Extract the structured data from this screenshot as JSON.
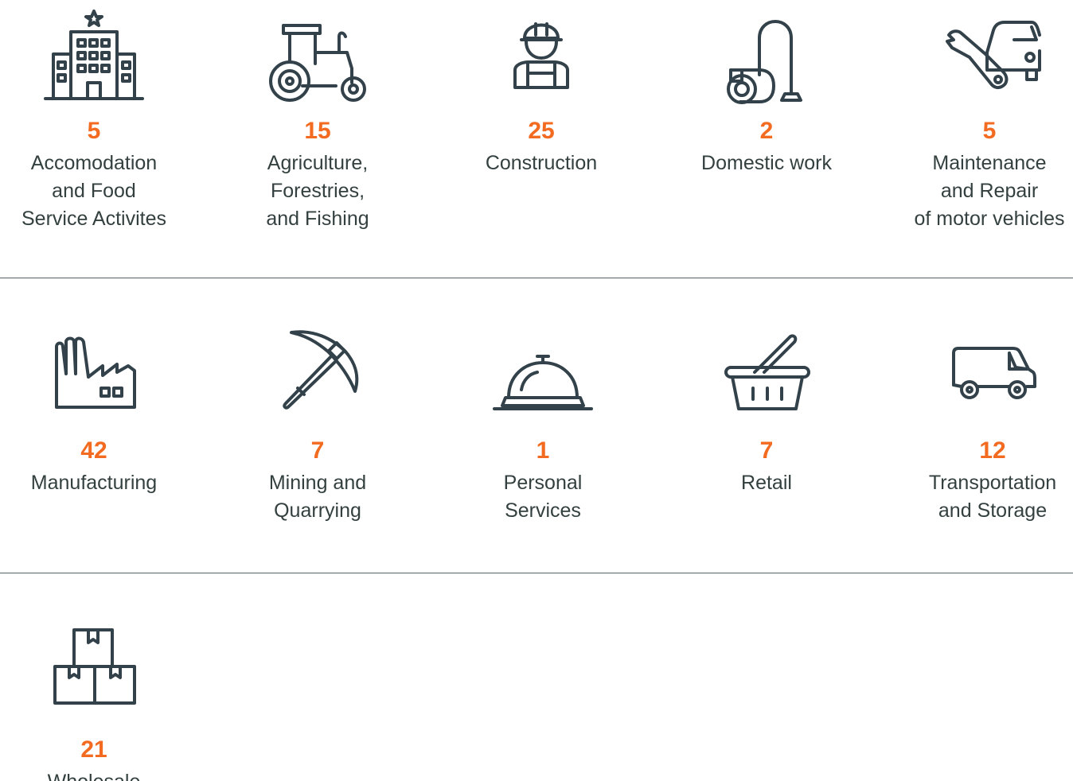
{
  "colors": {
    "accent": "#f26b21",
    "icon": "#33424a",
    "text": "#33403f",
    "divider": "#556066"
  },
  "sectors": [
    {
      "icon": "hotel-icon",
      "count": "5",
      "label": "Accomodation\nand Food\nService Activites"
    },
    {
      "icon": "tractor-icon",
      "count": "15",
      "label": "Agriculture,\nForestries,\nand Fishing"
    },
    {
      "icon": "construction-worker-icon",
      "count": "25",
      "label": "Construction"
    },
    {
      "icon": "vacuum-cleaner-icon",
      "count": "2",
      "label": "Domestic work"
    },
    {
      "icon": "car-wrench-icon",
      "count": "5",
      "label": "Maintenance\nand Repair\nof motor vehicles"
    },
    {
      "icon": "factory-icon",
      "count": "42",
      "label": "Manufacturing"
    },
    {
      "icon": "pickaxe-icon",
      "count": "7",
      "label": "Mining and\nQuarrying"
    },
    {
      "icon": "service-bell-icon",
      "count": "1",
      "label": "Personal\nServices"
    },
    {
      "icon": "shopping-basket-icon",
      "count": "7",
      "label": "Retail"
    },
    {
      "icon": "van-icon",
      "count": "12",
      "label": "Transportation\nand Storage"
    },
    {
      "icon": "boxes-icon",
      "count": "21",
      "label": "Wholesale"
    }
  ]
}
